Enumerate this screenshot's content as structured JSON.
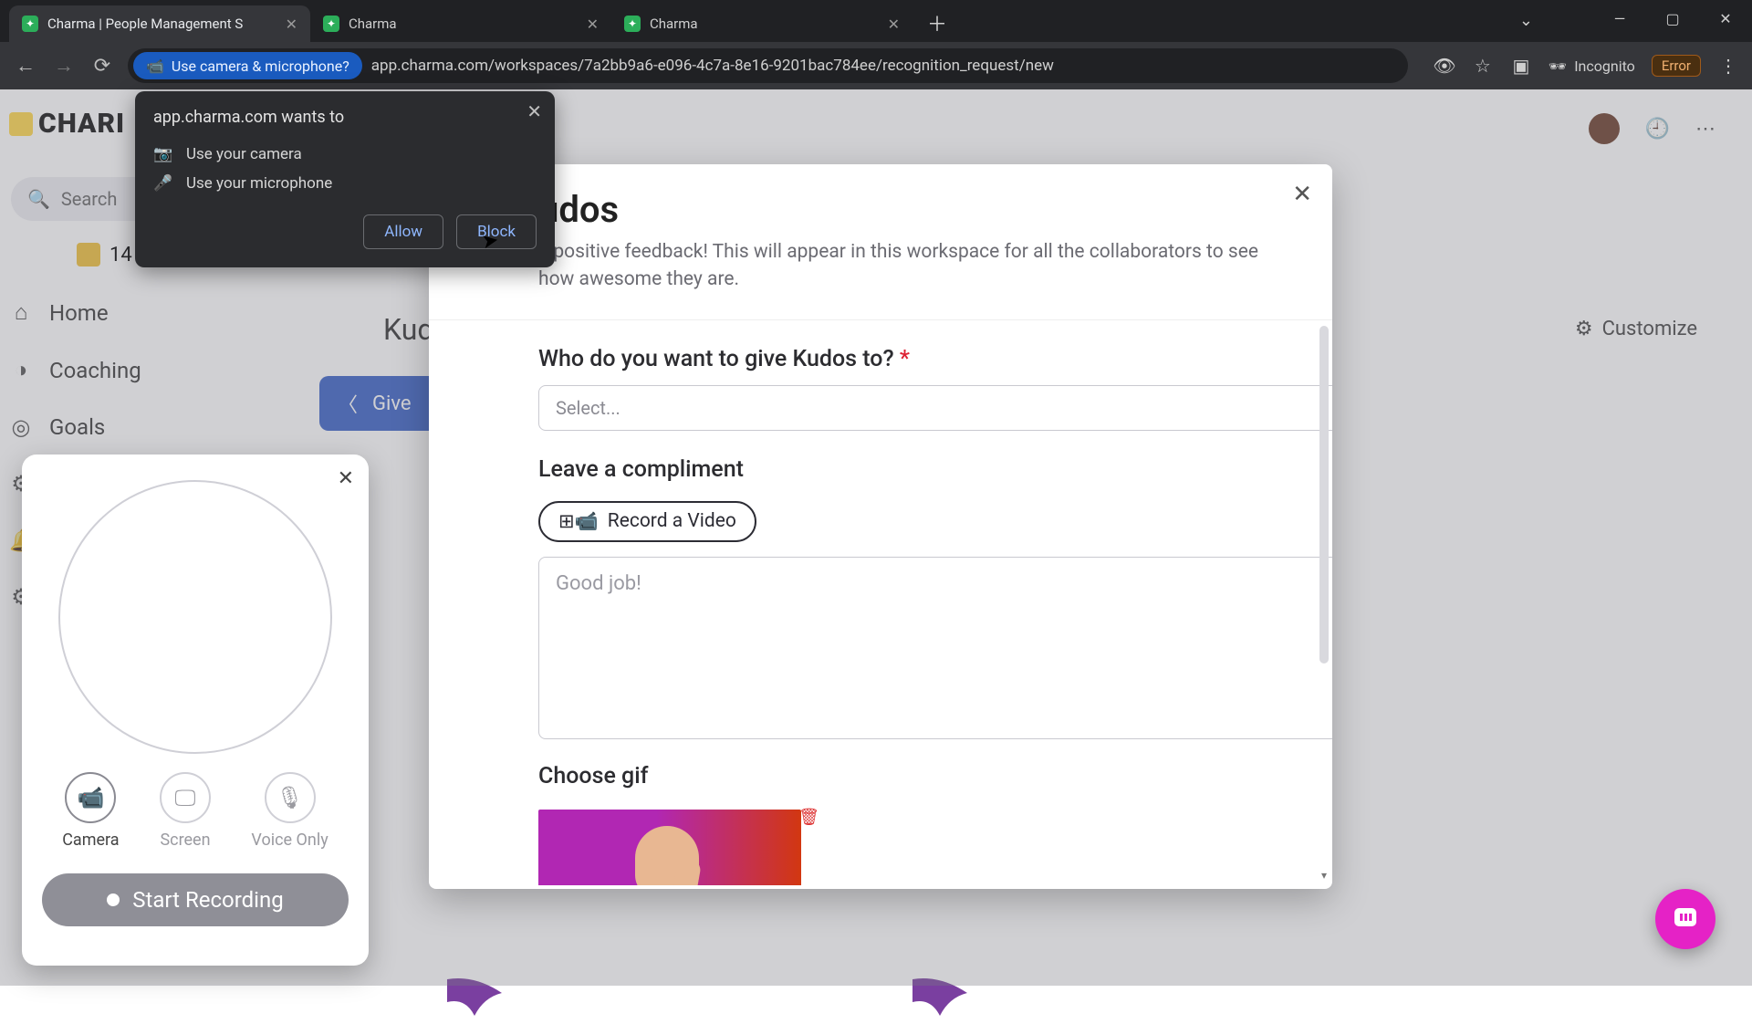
{
  "browser": {
    "tabs": [
      {
        "title": "Charma | People Management S",
        "active": true
      },
      {
        "title": "Charma",
        "active": false
      },
      {
        "title": "Charma",
        "active": false
      }
    ],
    "perm_chip": "Use camera & microphone?",
    "url": "app.charma.com/workspaces/7a2bb9a6-e096-4c7a-8e16-9201bac784ee/recognition_request/new",
    "incognito": "Incognito",
    "error_badge": "Error",
    "window_controls": {
      "min": "—",
      "max": "▢",
      "close": "✕"
    }
  },
  "permission_popup": {
    "title": "app.charma.com wants to",
    "rows": [
      "Use your camera",
      "Use your microphone"
    ],
    "allow": "Allow",
    "block": "Block"
  },
  "app": {
    "logo": "CHARI",
    "search_placeholder": "Search",
    "badge_count": "14",
    "sidenav": [
      "Home",
      "Coaching",
      "Goals"
    ],
    "customize": "Customize",
    "kudos_heading": "Kud",
    "give_button": "Give"
  },
  "modal": {
    "title_visible": "udos",
    "subtitle_visible": "e positive feedback! This will appear in this workspace for all the collaborators to see how awesome they are.",
    "q_who": "Who do you want to give Kudos to?",
    "select_placeholder": "Select...",
    "q_compliment": "Leave a compliment",
    "record_video": "Record a Video",
    "textarea_placeholder": "Good job!",
    "q_gif": "Choose gif"
  },
  "recorder": {
    "modes": {
      "camera": "Camera",
      "screen": "Screen",
      "voice": "Voice Only"
    },
    "start": "Start Recording"
  },
  "colors": {
    "accent_blue": "#3a62c7",
    "fab_pink": "#e522c6",
    "brand_yellow": "#ffd74a"
  }
}
